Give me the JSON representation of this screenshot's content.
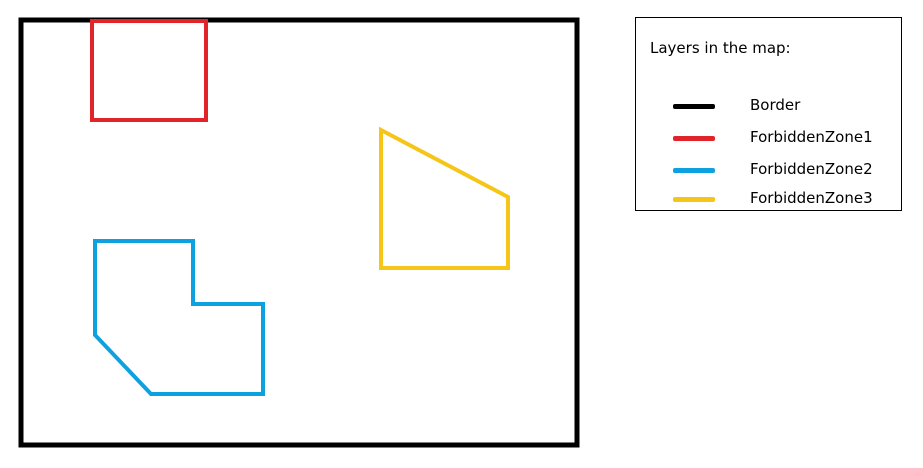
{
  "legend": {
    "title": "Layers in the map:",
    "items": [
      {
        "label": "Border",
        "color": "#000000"
      },
      {
        "label": "ForbiddenZone1",
        "color": "#e0242a"
      },
      {
        "label": "ForbiddenZone2",
        "color": "#0ea1e0"
      },
      {
        "label": "ForbiddenZone3",
        "color": "#f5c518"
      }
    ]
  },
  "layers": {
    "border": {
      "color": "#000000"
    },
    "forbidden_zone_1": {
      "color": "#e0242a"
    },
    "forbidden_zone_2": {
      "color": "#0ea1e0"
    },
    "forbidden_zone_3": {
      "color": "#f5c518"
    }
  }
}
